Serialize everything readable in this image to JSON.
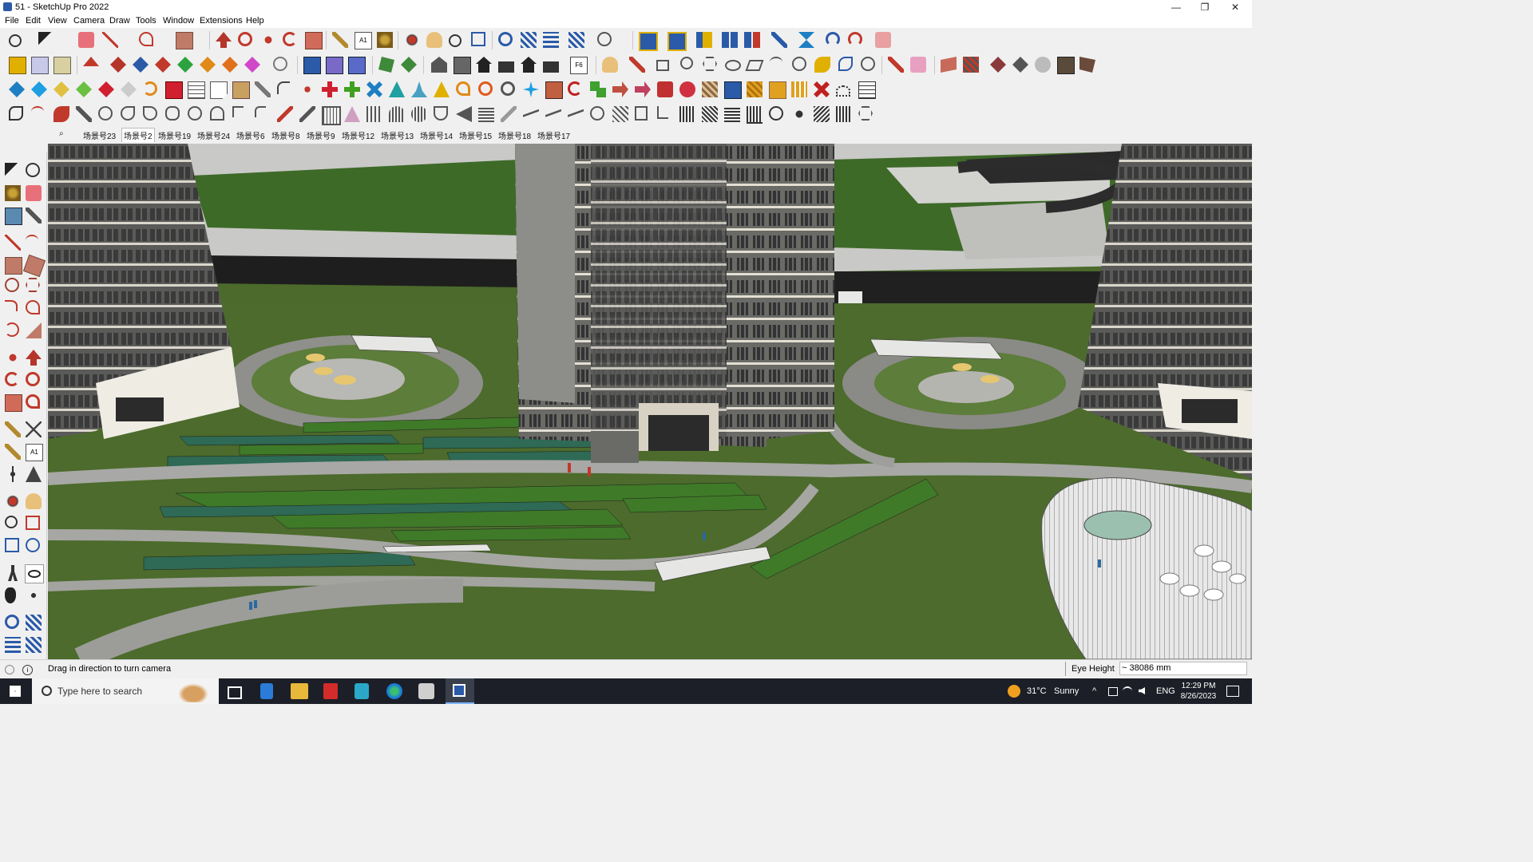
{
  "window": {
    "title": "51 - SketchUp Pro 2022",
    "minimize": "—",
    "restore": "❐",
    "close": "✕"
  },
  "menu": [
    "File",
    "Edit",
    "View",
    "Camera",
    "Draw",
    "Tools",
    "Window",
    "Extensions",
    "Help"
  ],
  "scenes": {
    "search_icon": "⌕",
    "tabs": [
      "场景号23",
      "场景号2",
      "场景号19",
      "场景号24",
      "场景号6",
      "场景号8",
      "场景号9",
      "场景号12",
      "场景号13",
      "场景号14",
      "场景号15",
      "场景号18",
      "场景号17"
    ],
    "active": "场景号2"
  },
  "status": {
    "message": "Drag in direction to turn camera",
    "measure_label": "Eye Height",
    "measure_value": "~ 38086 mm"
  },
  "taskbar": {
    "search_placeholder": "Type here to search",
    "weather_temp": "31°C",
    "weather_cond": "Sunny",
    "lang": "ENG",
    "time": "12:29 PM",
    "date": "8/26/2023"
  },
  "colors": {
    "accent": "#2b5aa8",
    "lawn": "#4c6b2c",
    "road": "#a9a9a6",
    "taskbar": "#1c1f27"
  }
}
